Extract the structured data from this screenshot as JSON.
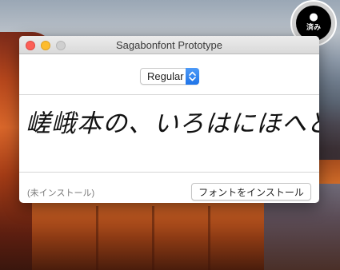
{
  "window": {
    "title": "Sagabonfont Prototype"
  },
  "style_select": {
    "selected": "Regular"
  },
  "preview": {
    "sample_text": "嵯峨本の、いろはにほへと。"
  },
  "footer": {
    "status": "(未インストール)",
    "install_button_label": "フォントをインストール"
  },
  "badge": {
    "apple_glyph": "",
    "text": "済み"
  },
  "colors": {
    "close": "#fc5f57",
    "minimize": "#fdbc2e",
    "zoom": "#cfcfcf",
    "select_accent": "#1f74e8"
  }
}
